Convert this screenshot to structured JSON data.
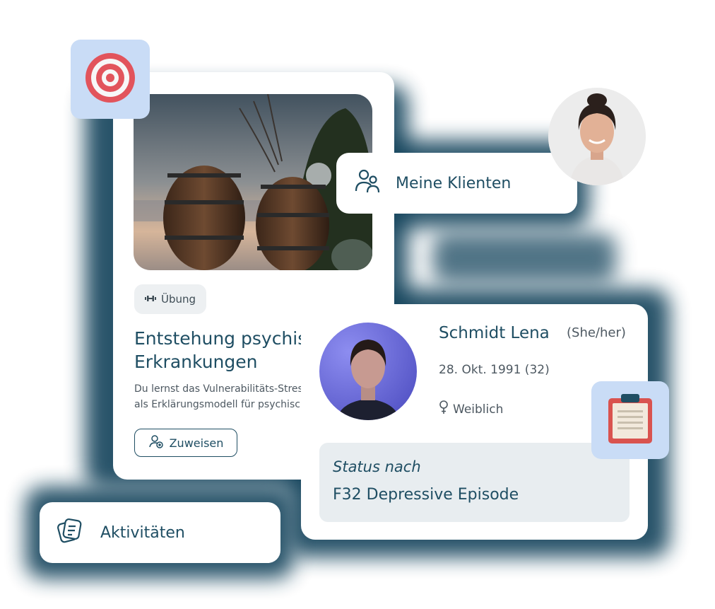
{
  "activity": {
    "tag_label": "Übung",
    "title_line1": "Entstehung psychischer",
    "title_line2": "Erkrankungen",
    "desc_line1": "Du lernst das Vulnerabilitäts-Stress-Modell",
    "desc_line2": "als Erklärungsmodell für psychische Erkrankungen",
    "assign_button": "Zuweisen"
  },
  "nav": {
    "clients_label": "Meine Klienten",
    "activities_label": "Aktivitäten"
  },
  "client": {
    "name": "Schmidt Lena",
    "pronouns": "(She/her)",
    "dob": "28. Okt. 1991 (32)",
    "gender": "Weiblich",
    "status_label": "Status nach",
    "status_value": "F32 Depressive Episode"
  },
  "icons": {
    "target": "target-icon",
    "clipboard": "clipboard-icon",
    "clients": "users-icon",
    "activities": "notes-icon",
    "assign": "user-plus-icon",
    "exercise": "dumbbell-icon",
    "gender": "female-symbol-icon"
  },
  "colors": {
    "primary": "#1f4e63",
    "halo": "#17465e",
    "tile": "#c9dcf6",
    "target_red": "#e2545c"
  }
}
